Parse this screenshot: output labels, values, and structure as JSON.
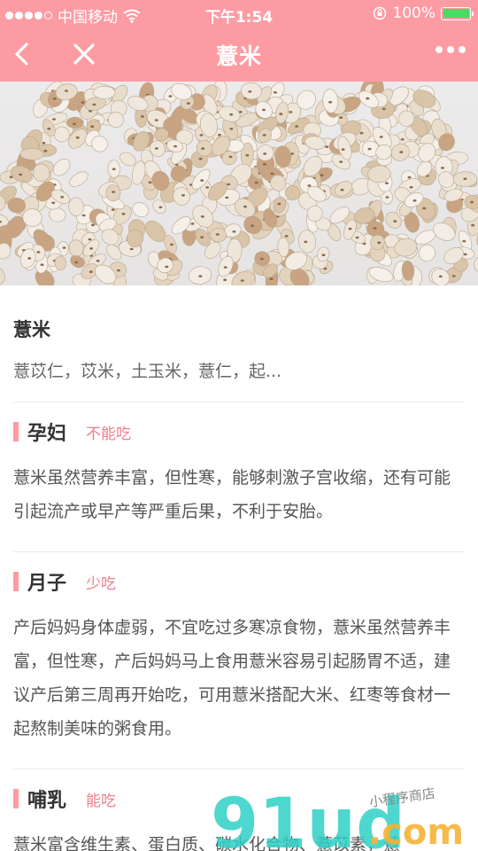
{
  "status_bar": {
    "carrier": "中国移动",
    "time": "下午1:54",
    "battery": "100%"
  },
  "nav": {
    "title": "薏米"
  },
  "intro": {
    "title": "薏米",
    "aliases": "薏苡仁，苡米，土玉米，薏仁，起..."
  },
  "sections": [
    {
      "title": "孕妇",
      "tag": "不能吃",
      "text": "薏米虽然营养丰富，但性寒，能够刺激子宫收缩，还有可能引起流产或早产等严重后果，不利于安胎。"
    },
    {
      "title": "月子",
      "tag": "少吃",
      "text": "产后妈妈身体虚弱，不宜吃过多寒凉食物，薏米虽然营养丰富，但性寒，产后妈妈马上食用薏米容易引起肠胃不适，建议产后第三周再开始吃，可用薏米搭配大米、红枣等食材一起熬制美味的粥食用。"
    },
    {
      "title": "哺乳",
      "tag": "能吃",
      "text": "薏米富含维生素、蛋白质、碳水化合物、薏苡素，薏"
    }
  ],
  "watermark": {
    "brand": "91ud",
    "suffix": ".com",
    "slogan": "小程序商店"
  },
  "colors": {
    "header_bg": "#fd9ba3",
    "accent_tag": "#f07d8b"
  }
}
